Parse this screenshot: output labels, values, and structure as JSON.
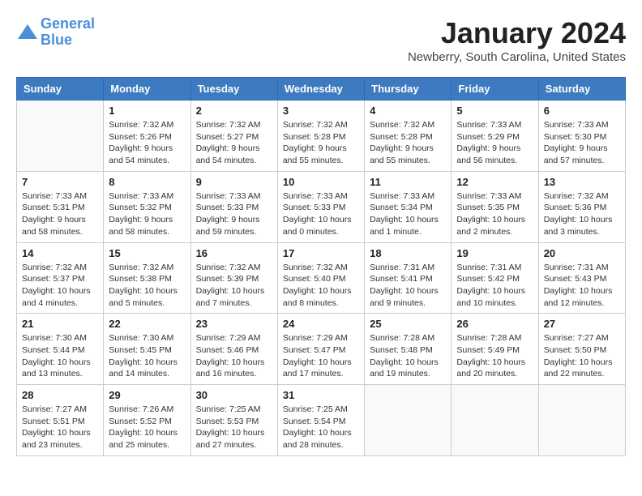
{
  "header": {
    "logo_line1": "General",
    "logo_line2": "Blue",
    "month": "January 2024",
    "location": "Newberry, South Carolina, United States"
  },
  "weekdays": [
    "Sunday",
    "Monday",
    "Tuesday",
    "Wednesday",
    "Thursday",
    "Friday",
    "Saturday"
  ],
  "weeks": [
    [
      {
        "day": "",
        "sunrise": "",
        "sunset": "",
        "daylight": ""
      },
      {
        "day": "1",
        "sunrise": "Sunrise: 7:32 AM",
        "sunset": "Sunset: 5:26 PM",
        "daylight": "Daylight: 9 hours and 54 minutes."
      },
      {
        "day": "2",
        "sunrise": "Sunrise: 7:32 AM",
        "sunset": "Sunset: 5:27 PM",
        "daylight": "Daylight: 9 hours and 54 minutes."
      },
      {
        "day": "3",
        "sunrise": "Sunrise: 7:32 AM",
        "sunset": "Sunset: 5:28 PM",
        "daylight": "Daylight: 9 hours and 55 minutes."
      },
      {
        "day": "4",
        "sunrise": "Sunrise: 7:32 AM",
        "sunset": "Sunset: 5:28 PM",
        "daylight": "Daylight: 9 hours and 55 minutes."
      },
      {
        "day": "5",
        "sunrise": "Sunrise: 7:33 AM",
        "sunset": "Sunset: 5:29 PM",
        "daylight": "Daylight: 9 hours and 56 minutes."
      },
      {
        "day": "6",
        "sunrise": "Sunrise: 7:33 AM",
        "sunset": "Sunset: 5:30 PM",
        "daylight": "Daylight: 9 hours and 57 minutes."
      }
    ],
    [
      {
        "day": "7",
        "sunrise": "Sunrise: 7:33 AM",
        "sunset": "Sunset: 5:31 PM",
        "daylight": "Daylight: 9 hours and 58 minutes."
      },
      {
        "day": "8",
        "sunrise": "Sunrise: 7:33 AM",
        "sunset": "Sunset: 5:32 PM",
        "daylight": "Daylight: 9 hours and 58 minutes."
      },
      {
        "day": "9",
        "sunrise": "Sunrise: 7:33 AM",
        "sunset": "Sunset: 5:33 PM",
        "daylight": "Daylight: 9 hours and 59 minutes."
      },
      {
        "day": "10",
        "sunrise": "Sunrise: 7:33 AM",
        "sunset": "Sunset: 5:33 PM",
        "daylight": "Daylight: 10 hours and 0 minutes."
      },
      {
        "day": "11",
        "sunrise": "Sunrise: 7:33 AM",
        "sunset": "Sunset: 5:34 PM",
        "daylight": "Daylight: 10 hours and 1 minute."
      },
      {
        "day": "12",
        "sunrise": "Sunrise: 7:33 AM",
        "sunset": "Sunset: 5:35 PM",
        "daylight": "Daylight: 10 hours and 2 minutes."
      },
      {
        "day": "13",
        "sunrise": "Sunrise: 7:32 AM",
        "sunset": "Sunset: 5:36 PM",
        "daylight": "Daylight: 10 hours and 3 minutes."
      }
    ],
    [
      {
        "day": "14",
        "sunrise": "Sunrise: 7:32 AM",
        "sunset": "Sunset: 5:37 PM",
        "daylight": "Daylight: 10 hours and 4 minutes."
      },
      {
        "day": "15",
        "sunrise": "Sunrise: 7:32 AM",
        "sunset": "Sunset: 5:38 PM",
        "daylight": "Daylight: 10 hours and 5 minutes."
      },
      {
        "day": "16",
        "sunrise": "Sunrise: 7:32 AM",
        "sunset": "Sunset: 5:39 PM",
        "daylight": "Daylight: 10 hours and 7 minutes."
      },
      {
        "day": "17",
        "sunrise": "Sunrise: 7:32 AM",
        "sunset": "Sunset: 5:40 PM",
        "daylight": "Daylight: 10 hours and 8 minutes."
      },
      {
        "day": "18",
        "sunrise": "Sunrise: 7:31 AM",
        "sunset": "Sunset: 5:41 PM",
        "daylight": "Daylight: 10 hours and 9 minutes."
      },
      {
        "day": "19",
        "sunrise": "Sunrise: 7:31 AM",
        "sunset": "Sunset: 5:42 PM",
        "daylight": "Daylight: 10 hours and 10 minutes."
      },
      {
        "day": "20",
        "sunrise": "Sunrise: 7:31 AM",
        "sunset": "Sunset: 5:43 PM",
        "daylight": "Daylight: 10 hours and 12 minutes."
      }
    ],
    [
      {
        "day": "21",
        "sunrise": "Sunrise: 7:30 AM",
        "sunset": "Sunset: 5:44 PM",
        "daylight": "Daylight: 10 hours and 13 minutes."
      },
      {
        "day": "22",
        "sunrise": "Sunrise: 7:30 AM",
        "sunset": "Sunset: 5:45 PM",
        "daylight": "Daylight: 10 hours and 14 minutes."
      },
      {
        "day": "23",
        "sunrise": "Sunrise: 7:29 AM",
        "sunset": "Sunset: 5:46 PM",
        "daylight": "Daylight: 10 hours and 16 minutes."
      },
      {
        "day": "24",
        "sunrise": "Sunrise: 7:29 AM",
        "sunset": "Sunset: 5:47 PM",
        "daylight": "Daylight: 10 hours and 17 minutes."
      },
      {
        "day": "25",
        "sunrise": "Sunrise: 7:28 AM",
        "sunset": "Sunset: 5:48 PM",
        "daylight": "Daylight: 10 hours and 19 minutes."
      },
      {
        "day": "26",
        "sunrise": "Sunrise: 7:28 AM",
        "sunset": "Sunset: 5:49 PM",
        "daylight": "Daylight: 10 hours and 20 minutes."
      },
      {
        "day": "27",
        "sunrise": "Sunrise: 7:27 AM",
        "sunset": "Sunset: 5:50 PM",
        "daylight": "Daylight: 10 hours and 22 minutes."
      }
    ],
    [
      {
        "day": "28",
        "sunrise": "Sunrise: 7:27 AM",
        "sunset": "Sunset: 5:51 PM",
        "daylight": "Daylight: 10 hours and 23 minutes."
      },
      {
        "day": "29",
        "sunrise": "Sunrise: 7:26 AM",
        "sunset": "Sunset: 5:52 PM",
        "daylight": "Daylight: 10 hours and 25 minutes."
      },
      {
        "day": "30",
        "sunrise": "Sunrise: 7:25 AM",
        "sunset": "Sunset: 5:53 PM",
        "daylight": "Daylight: 10 hours and 27 minutes."
      },
      {
        "day": "31",
        "sunrise": "Sunrise: 7:25 AM",
        "sunset": "Sunset: 5:54 PM",
        "daylight": "Daylight: 10 hours and 28 minutes."
      },
      {
        "day": "",
        "sunrise": "",
        "sunset": "",
        "daylight": ""
      },
      {
        "day": "",
        "sunrise": "",
        "sunset": "",
        "daylight": ""
      },
      {
        "day": "",
        "sunrise": "",
        "sunset": "",
        "daylight": ""
      }
    ]
  ]
}
